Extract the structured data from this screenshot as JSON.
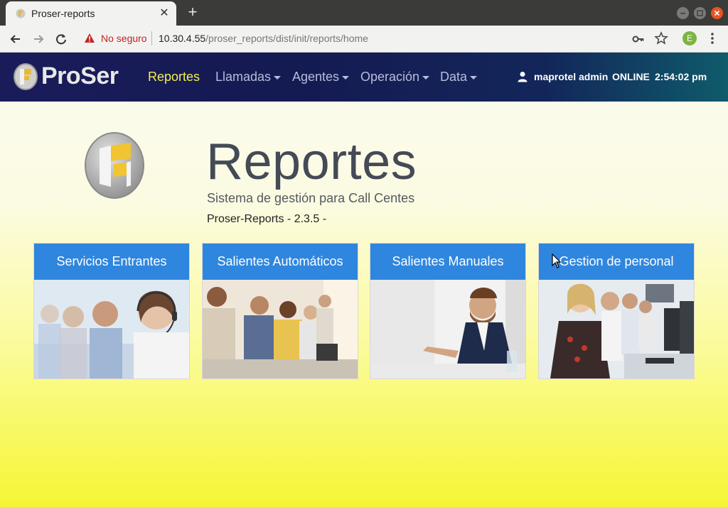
{
  "browser": {
    "tab_title": "Proser-reports",
    "new_tab_label": "+",
    "not_secure_label": "No seguro",
    "url_host": "10.30.4.55",
    "url_path": "/proser_reports/dist/init/reports/home",
    "profile_initial": "E"
  },
  "navbar": {
    "brand": "ProSer",
    "items": [
      {
        "label": "Reportes",
        "active": true,
        "dropdown": false
      },
      {
        "label": "Llamadas",
        "active": false,
        "dropdown": true
      },
      {
        "label": "Agentes",
        "active": false,
        "dropdown": true
      },
      {
        "label": "Operación",
        "active": false,
        "dropdown": true
      },
      {
        "label": "Data",
        "active": false,
        "dropdown": true
      }
    ],
    "user": "maprotel admin",
    "status": "ONLINE",
    "time": "2:54:02 pm"
  },
  "hero": {
    "title": "Reportes",
    "subtitle": "Sistema de gestión para Call Centes",
    "version": "Proser-Reports - 2.3.5 -"
  },
  "cards": [
    {
      "label": "Servicios Entrantes",
      "image": "agent-headset-photo"
    },
    {
      "label": "Salientes Automáticos",
      "image": "call-center-row-photo"
    },
    {
      "label": "Salientes Manuales",
      "image": "agent-desk-photo"
    },
    {
      "label": "Gestion de personal",
      "image": "office-team-photo"
    }
  ],
  "colors": {
    "navbar_start": "#1a1c5a",
    "navbar_end": "#0f5b6b",
    "active_nav": "#f5f04a",
    "card_header": "#2f86de",
    "page_bg_bottom": "#f5f535"
  }
}
